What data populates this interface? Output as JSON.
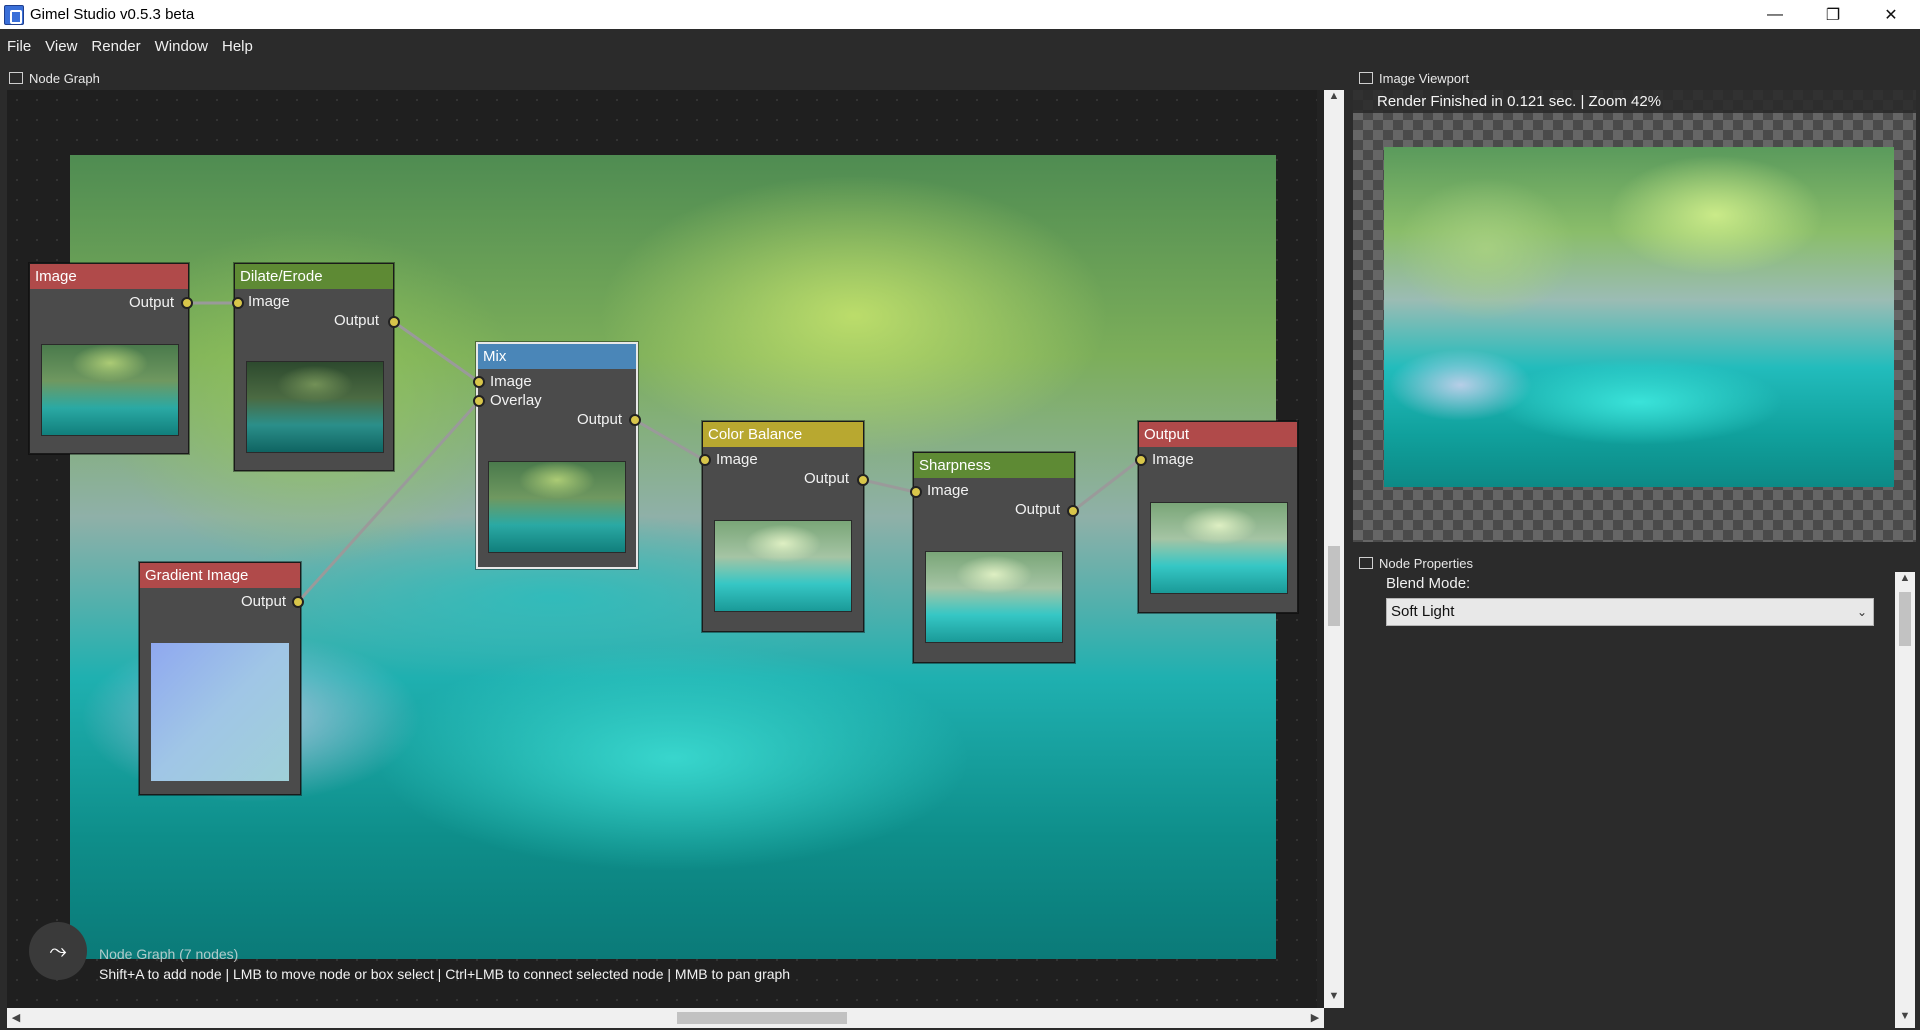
{
  "window": {
    "title": "Gimel Studio v0.5.3 beta",
    "controls": {
      "minimize": "—",
      "maximize": "❐",
      "close": "✕"
    }
  },
  "menu": [
    "File",
    "View",
    "Render",
    "Window",
    "Help"
  ],
  "panels": {
    "node_graph": {
      "title": "Node Graph"
    },
    "image_viewport": {
      "title": "Image Viewport",
      "status": "Render Finished in 0.121 sec. | Zoom 42%"
    },
    "node_properties": {
      "title": "Node Properties"
    }
  },
  "graph": {
    "hud_title": "Node Graph (7 nodes)",
    "hud_help": "Shift+A to add node | LMB to move node or box select | Ctrl+LMB to connect selected node | MMB to pan graph"
  },
  "nodes": {
    "image": {
      "title": "Image",
      "color": "#b04a4a",
      "output": "Output"
    },
    "dilate": {
      "title": "Dilate/Erode",
      "color": "#5e8a34",
      "input": "Image",
      "output": "Output"
    },
    "gradient": {
      "title": "Gradient Image",
      "color": "#b04a4a",
      "output": "Output"
    },
    "mix": {
      "title": "Mix",
      "color": "#4a86b8",
      "input1": "Image",
      "input2": "Overlay",
      "output": "Output"
    },
    "color_balance": {
      "title": "Color Balance",
      "color": "#b8a830",
      "input": "Image",
      "output": "Output"
    },
    "sharpness": {
      "title": "Sharpness",
      "color": "#5e8a34",
      "input": "Image",
      "output": "Output"
    },
    "output": {
      "title": "Output",
      "color": "#b04a4a",
      "input": "Image"
    }
  },
  "properties": {
    "blend_mode_label": "Blend Mode:",
    "blend_mode_value": "Soft Light"
  },
  "icons": {
    "scroll_up": "▲",
    "scroll_down": "▼",
    "scroll_left": "◀",
    "scroll_right": "▶",
    "hud": "⤳",
    "dropdown": "⌄"
  }
}
